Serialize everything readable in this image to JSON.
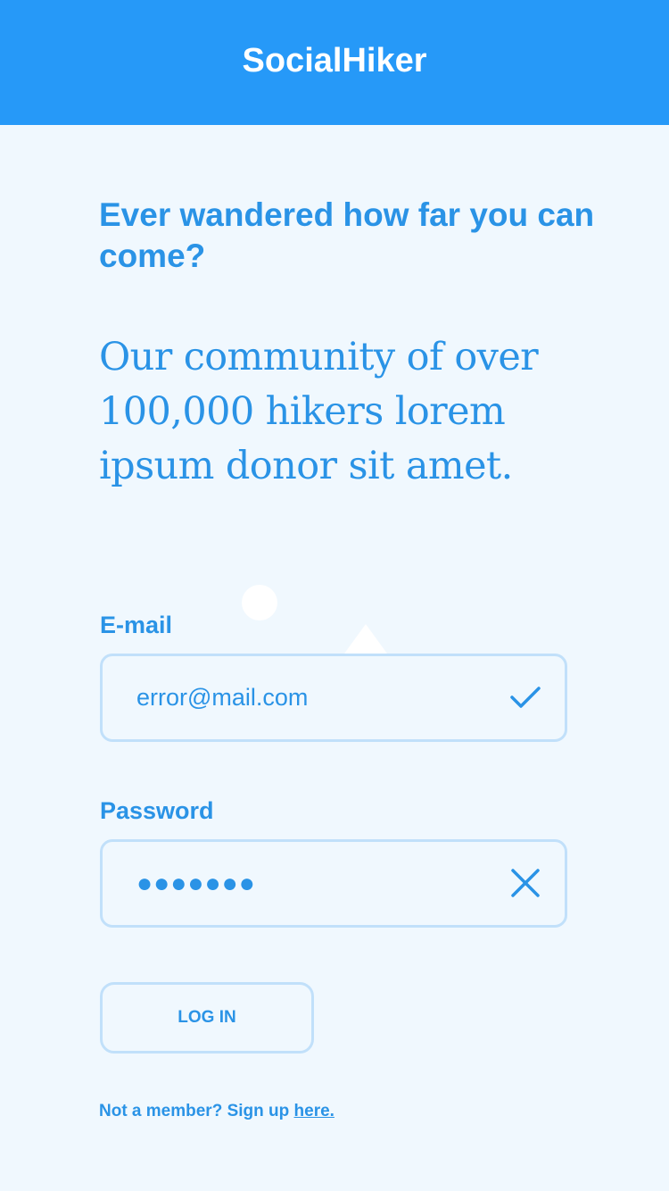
{
  "header": {
    "title": "SocialHiker",
    "background_color": "#2699f8"
  },
  "hero": {
    "headline": "Ever wandered how far you can come?",
    "intro": "Our community of over 100,000 hikers lorem ipsum donor sit amet."
  },
  "form": {
    "email": {
      "label": "E-mail",
      "value": "error@mail.com",
      "status_icon": "checkmark-icon"
    },
    "password": {
      "label": "Password",
      "value": "●●●●●●●",
      "status_icon": "close-icon"
    },
    "login_label": "LOG IN"
  },
  "signup": {
    "prompt": "Not a member? Sign up ",
    "link_text": "here."
  },
  "colors": {
    "accent": "#2a93e6",
    "page_background": "#f0f8fe",
    "field_border": "#c1e0fa"
  }
}
